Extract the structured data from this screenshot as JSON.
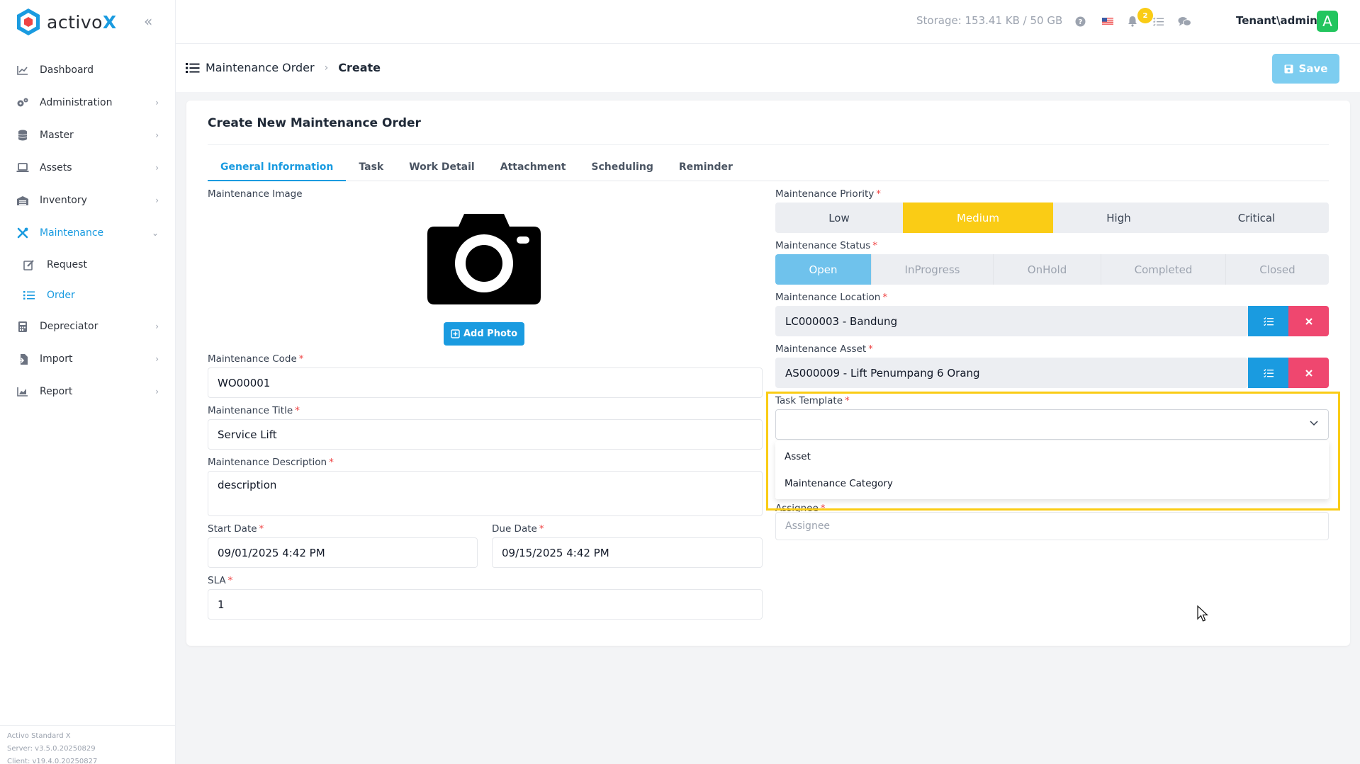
{
  "app": {
    "logo_text": "activo",
    "logo_x": "X",
    "storage": "Storage: 153.41 KB / 50 GB",
    "notification_count": "2",
    "user": "Tenant\\admin",
    "avatar_letter": "A"
  },
  "sidebar": {
    "items": [
      {
        "label": "Dashboard",
        "icon": "chart-line-icon"
      },
      {
        "label": "Administration",
        "icon": "gears-icon"
      },
      {
        "label": "Master",
        "icon": "database-icon"
      },
      {
        "label": "Assets",
        "icon": "laptop-icon"
      },
      {
        "label": "Inventory",
        "icon": "warehouse-icon"
      },
      {
        "label": "Maintenance",
        "icon": "tools-icon"
      },
      {
        "label": "Depreciator",
        "icon": "calculator-icon"
      },
      {
        "label": "Import",
        "icon": "import-icon"
      },
      {
        "label": "Report",
        "icon": "chart-area-icon"
      }
    ],
    "sub_items": [
      {
        "label": "Request",
        "icon": "edit-icon"
      },
      {
        "label": "Order",
        "icon": "list-icon"
      }
    ],
    "footer": {
      "product": "Activo Standard X",
      "server": "Server: v3.5.0.20250829",
      "client": "Client: v19.4.0.20250827"
    }
  },
  "breadcrumb": {
    "parent": "Maintenance Order",
    "current": "Create"
  },
  "toolbar": {
    "save_label": "Save"
  },
  "form": {
    "title": "Create New Maintenance Order",
    "tabs": [
      "General Information",
      "Task",
      "Work Detail",
      "Attachment",
      "Scheduling",
      "Reminder"
    ],
    "active_tab": "General Information",
    "image_label": "Maintenance Image",
    "add_photo_label": "Add Photo",
    "code": {
      "label": "Maintenance Code",
      "value": "WO00001"
    },
    "title_field": {
      "label": "Maintenance Title",
      "value": "Service Lift"
    },
    "description": {
      "label": "Maintenance Description",
      "value": "description"
    },
    "start_date": {
      "label": "Start Date",
      "value": "09/01/2025 4:42 PM"
    },
    "due_date": {
      "label": "Due Date",
      "value": "09/15/2025 4:42 PM"
    },
    "sla": {
      "label": "SLA",
      "value": "1"
    },
    "priority": {
      "label": "Maintenance Priority",
      "options": [
        "Low",
        "Medium",
        "High",
        "Critical"
      ],
      "selected": "Medium"
    },
    "status": {
      "label": "Maintenance Status",
      "options": [
        "Open",
        "InProgress",
        "OnHold",
        "Completed",
        "Closed"
      ],
      "selected": "Open"
    },
    "location": {
      "label": "Maintenance Location",
      "value": "LC000003 - Bandung"
    },
    "asset": {
      "label": "Maintenance Asset",
      "value": "AS000009 - Lift Penumpang 6 Orang"
    },
    "task_template": {
      "label": "Task Template",
      "value": "",
      "options": [
        "Asset",
        "Maintenance Category"
      ]
    },
    "assignee": {
      "label": "Assignee",
      "placeholder": "Assignee"
    }
  },
  "colors": {
    "accent": "#1a9be0",
    "priority_selected": "#facc15",
    "status_selected": "#6fc2ec",
    "danger": "#ef476f",
    "highlight": "#facc15"
  }
}
